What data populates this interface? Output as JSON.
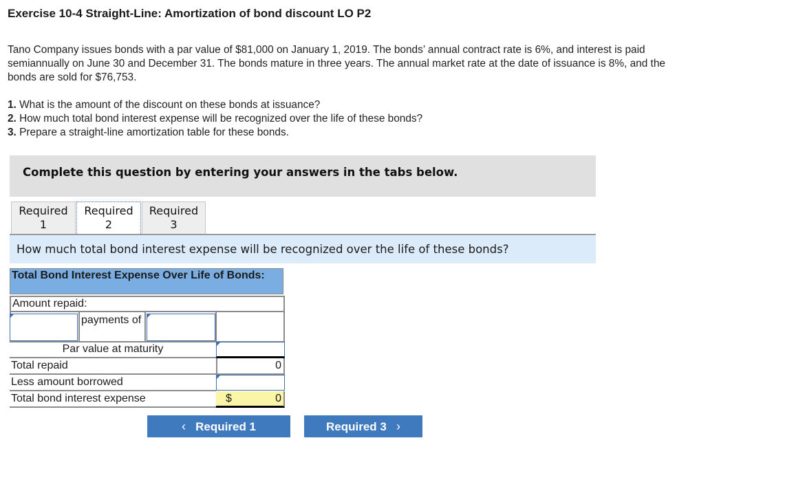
{
  "title": "Exercise 10-4 Straight-Line: Amortization of bond discount LO P2",
  "intro": "Tano Company issues bonds with a par value of $81,000 on January 1, 2019. The bonds’ annual contract rate is 6%, and interest is paid semiannually on June 30 and December 31. The bonds mature in three years. The annual market rate at the date of issuance is 8%, and the bonds are sold for $76,753.",
  "questions": [
    {
      "num": "1.",
      "text": " What is the amount of the discount on these bonds at issuance?"
    },
    {
      "num": "2.",
      "text": " How much total bond interest expense will be recognized over the life of these bonds?"
    },
    {
      "num": "3.",
      "text": " Prepare a straight-line amortization table for these bonds."
    }
  ],
  "banner": "Complete this question by entering your answers in the tabs below.",
  "tabs": [
    {
      "line1": "Required",
      "line2": "1",
      "active": false
    },
    {
      "line1": "Required",
      "line2": "2",
      "active": true
    },
    {
      "line1": "Required",
      "line2": "3",
      "active": false
    }
  ],
  "question_bar": "How much total bond interest expense will be recognized over the life of these bonds?",
  "table": {
    "header": "Total Bond Interest Expense Over Life of Bonds:",
    "amount_repaid_label": "Amount repaid:",
    "payments_count_value": "",
    "payments_of_label": "payments of",
    "payment_amount_value": "",
    "par_value_label": "Par value at maturity",
    "par_value_input": "",
    "total_repaid_label": "Total repaid",
    "total_repaid_value": "0",
    "less_borrowed_label": "Less amount borrowed",
    "less_borrowed_input": "",
    "total_expense_label": "Total bond interest expense",
    "total_expense_currency": "$",
    "total_expense_value": "0"
  },
  "nav": {
    "prev_label": "Required 1",
    "next_label": "Required 3",
    "prev_icon": "‹",
    "next_icon": "›"
  },
  "colors": {
    "header_bg": "#7aaee3",
    "question_bar_bg": "#dcebf9",
    "button_bg": "#3f7abf",
    "total_highlight": "#fbf5a8"
  }
}
